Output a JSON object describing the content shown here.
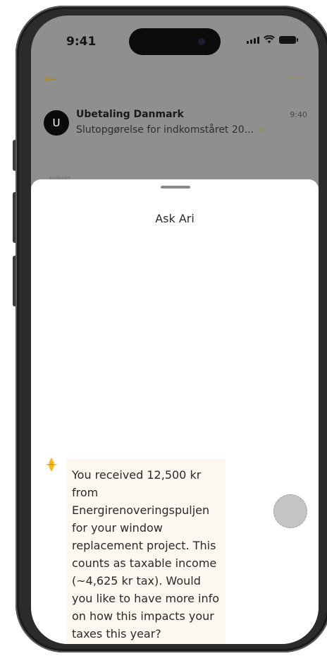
{
  "status_bar": {
    "time": "9:41"
  },
  "email": {
    "avatar_letter": "U",
    "sender": "Ubetaling Danmark",
    "subject": "Slutopgørelse for indkomståret 20...",
    "time": "9:40",
    "faint_label": "Indhold"
  },
  "sheet": {
    "title": "Ask Ari",
    "message": "You received 12,500 kr from Energirenoveringspuljen for your window replacement project. This counts as taxable income (~4,625 kr tax). Would you like to have more info on how this impacts your taxes this year?"
  },
  "icons": {
    "back": "arrow-left-icon",
    "more": "ellipsis-icon",
    "chevron": "chevron-down-icon",
    "ari": "ari-sparkle-icon",
    "mic": "voice-button"
  },
  "colors": {
    "accent": "#a88a2a",
    "ari_icon": "#f5b719",
    "bubble": "#fdf8ef"
  }
}
